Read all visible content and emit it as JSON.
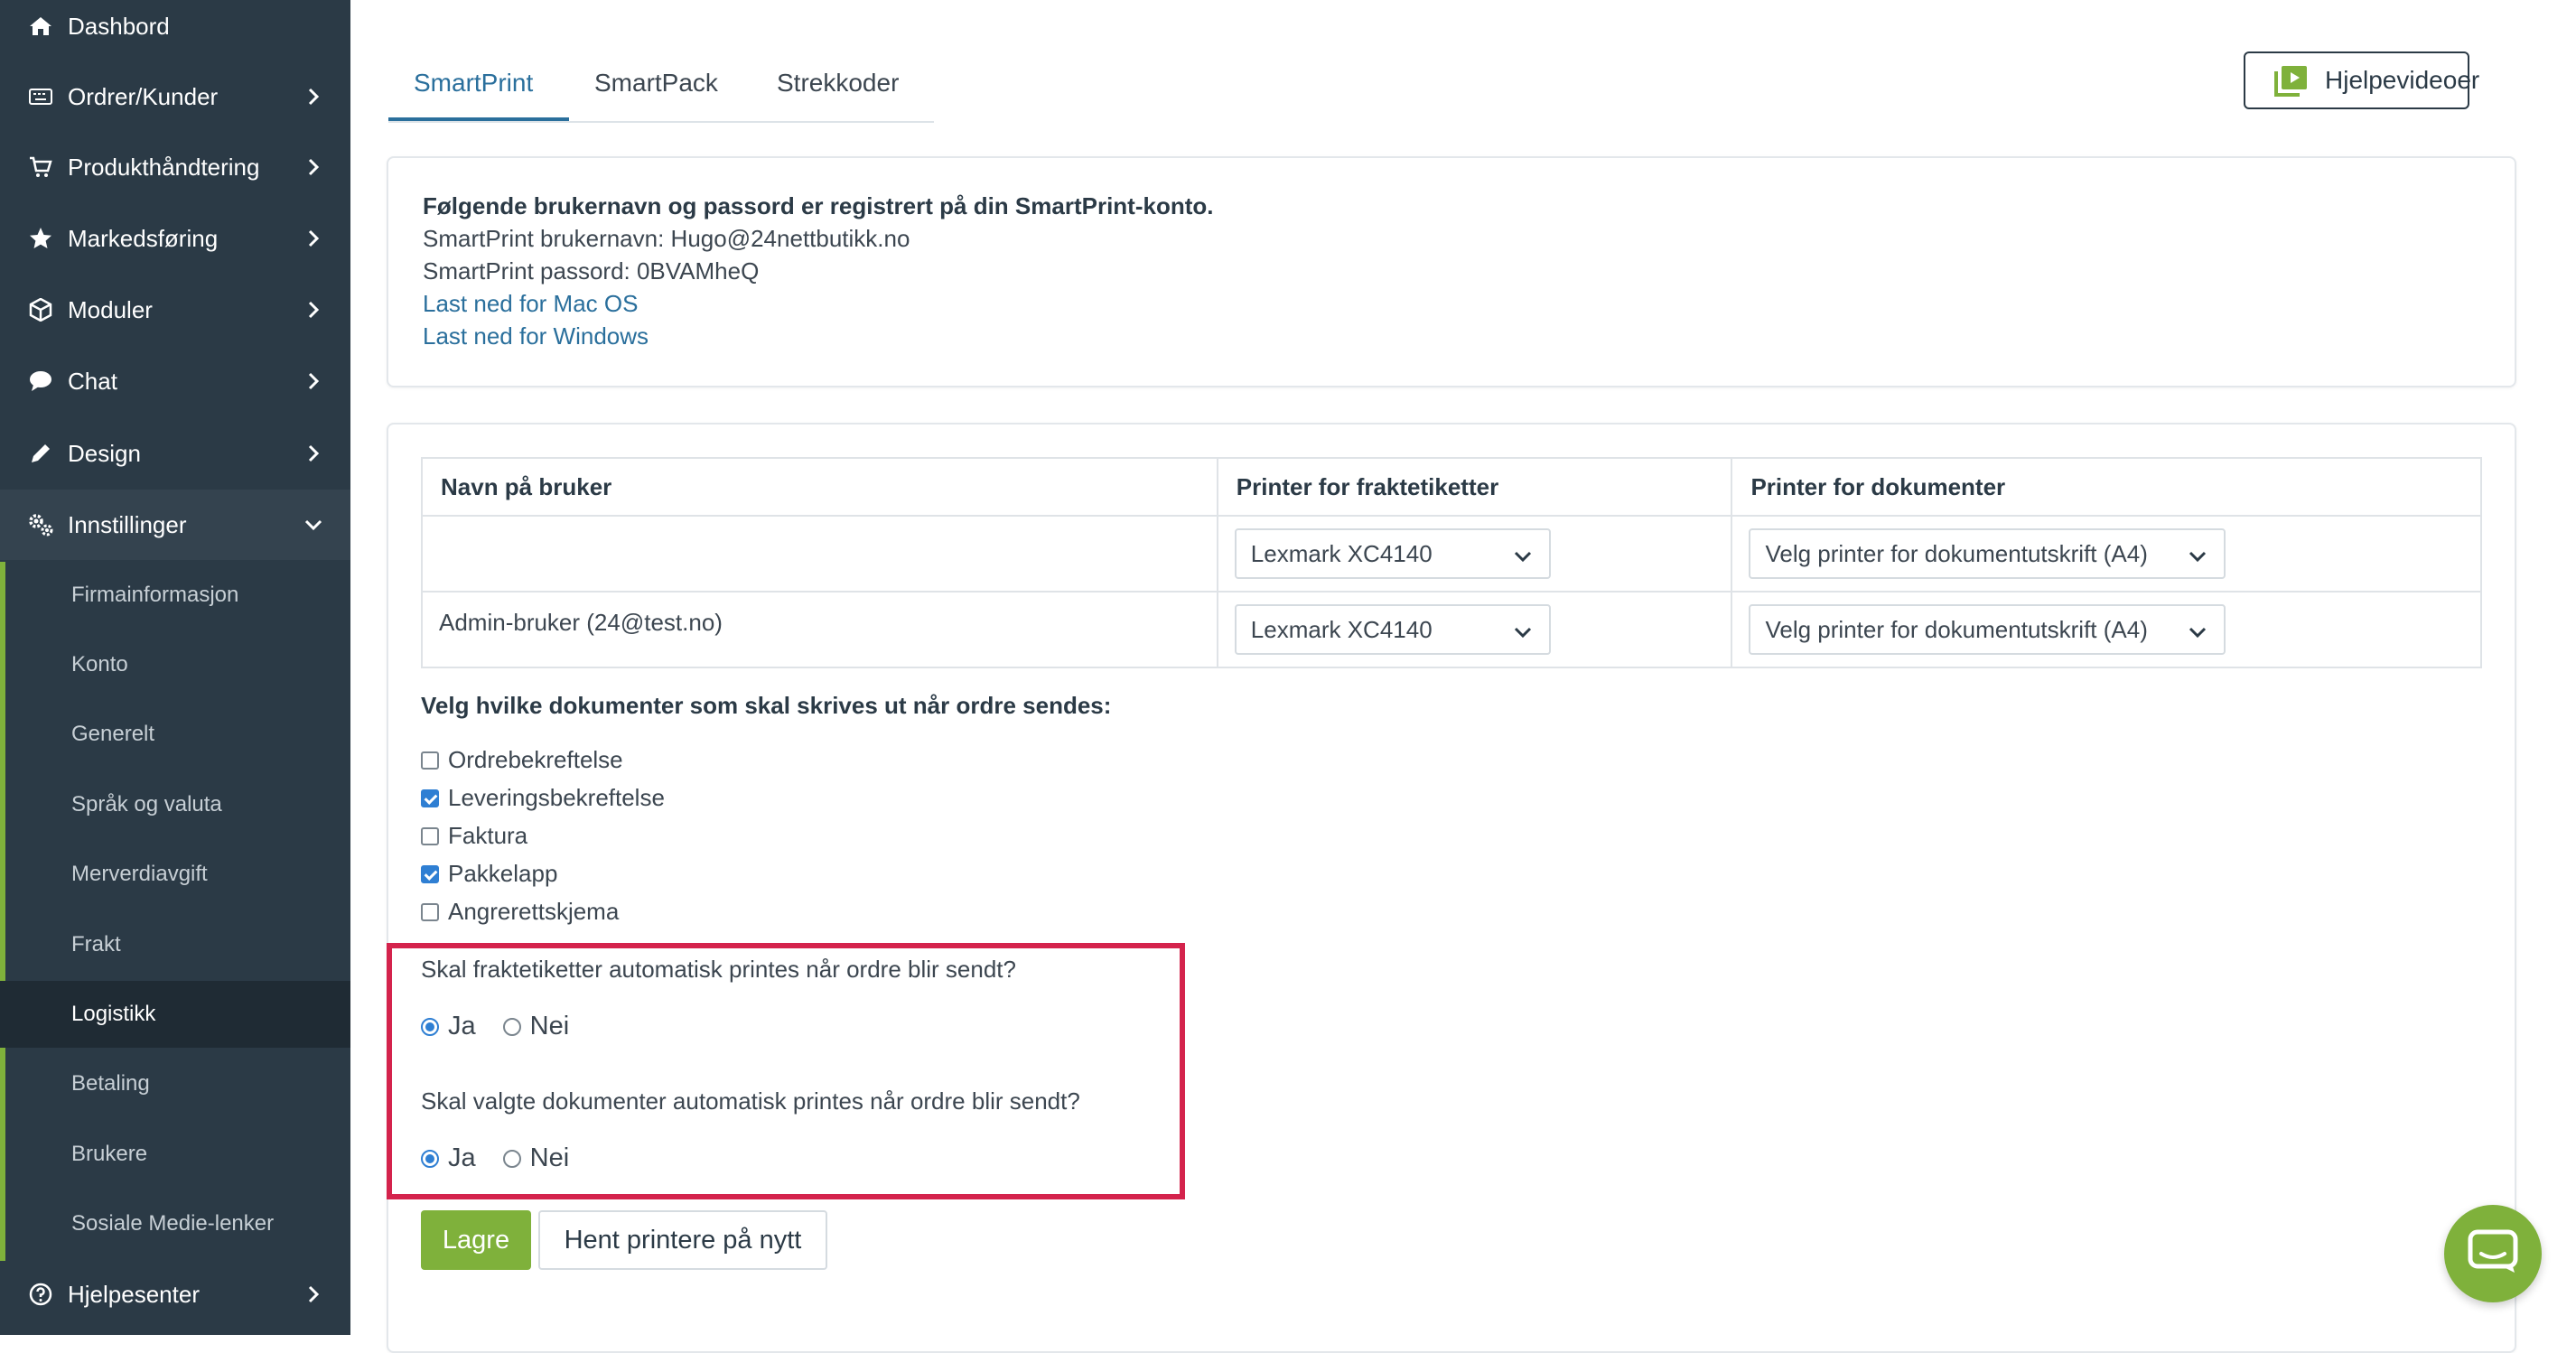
{
  "sidebar": {
    "items": [
      {
        "label": "Dashbord",
        "icon": "home-icon"
      },
      {
        "label": "Ordrer/Kunder",
        "icon": "keyboard-icon"
      },
      {
        "label": "Produkthåndtering",
        "icon": "cart-icon"
      },
      {
        "label": "Markedsføring",
        "icon": "star-icon"
      },
      {
        "label": "Moduler",
        "icon": "cube-icon"
      },
      {
        "label": "Chat",
        "icon": "chat-bubble-icon"
      },
      {
        "label": "Design",
        "icon": "pencil-icon"
      },
      {
        "label": "Innstillinger",
        "icon": "cogs-icon"
      },
      {
        "label": "Hjelpesenter",
        "icon": "question-circle-icon"
      }
    ],
    "submenu": [
      "Firmainformasjon",
      "Konto",
      "Generelt",
      "Språk og valuta",
      "Merverdiavgift",
      "Frakt",
      "Logistikk",
      "Betaling",
      "Brukere",
      "Sosiale Medie-lenker"
    ],
    "active_sub": "Logistikk"
  },
  "tabs": [
    "SmartPrint",
    "SmartPack",
    "Strekkoder"
  ],
  "active_tab": "SmartPrint",
  "help_button": "Hjelpevideoer",
  "info": {
    "heading": "Følgende brukernavn og passord er registrert på din SmartPrint-konto.",
    "username_line": "SmartPrint brukernavn: Hugo@24nettbutikk.no",
    "password_line": "SmartPrint passord: 0BVAMheQ",
    "link_mac": "Last ned for Mac OS",
    "link_windows": "Last ned for Windows"
  },
  "printer_table": {
    "headers": [
      "Navn på bruker",
      "Printer for fraktetiketter",
      "Printer for dokumenter"
    ],
    "rows": [
      {
        "name": "",
        "label_printer": "Lexmark XC4140",
        "doc_printer": "Velg printer for dokumentutskrift (A4)"
      },
      {
        "name": "Admin-bruker (24@test.no)",
        "label_printer": "Lexmark XC4140",
        "doc_printer": "Velg printer for dokumentutskrift (A4)"
      }
    ]
  },
  "documents": {
    "title": "Velg hvilke dokumenter som skal skrives ut når ordre sendes:",
    "items": [
      {
        "label": "Ordrebekreftelse",
        "checked": false
      },
      {
        "label": "Leveringsbekreftelse",
        "checked": true
      },
      {
        "label": "Faktura",
        "checked": false
      },
      {
        "label": "Pakkelapp",
        "checked": true
      },
      {
        "label": "Angrerettskjema",
        "checked": false
      }
    ]
  },
  "questions": [
    {
      "text": "Skal fraktetiketter automatisk printes når ordre blir sendt?",
      "yes": "Ja",
      "no": "Nei",
      "selected": "Ja"
    },
    {
      "text": "Skal valgte dokumenter automatisk printes når ordre blir sendt?",
      "yes": "Ja",
      "no": "Nei",
      "selected": "Ja"
    }
  ],
  "buttons": {
    "save": "Lagre",
    "refresh": "Hent printere på nytt"
  },
  "colors": {
    "sidebar": "#2b3a46",
    "accent": "#7fb13b",
    "link": "#2a6f9c",
    "highlight": "#d4234c"
  }
}
